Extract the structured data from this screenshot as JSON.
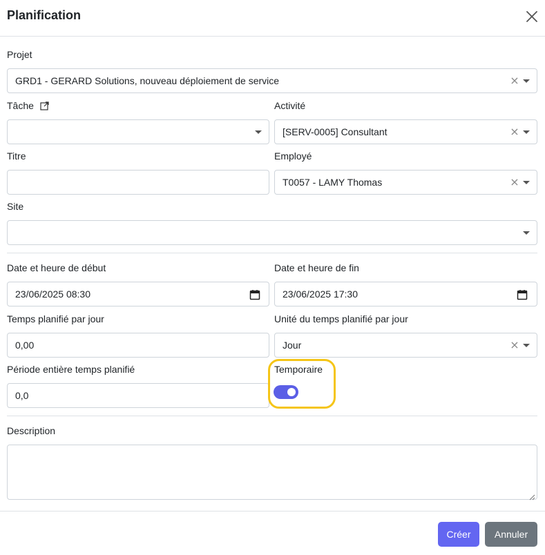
{
  "dialog": {
    "title": "Planification"
  },
  "form": {
    "projet": {
      "label": "Projet",
      "value": "GRD1 - GERARD Solutions, nouveau déploiement de service"
    },
    "tache": {
      "label": "Tâche",
      "value": ""
    },
    "activite": {
      "label": "Activité",
      "value": "[SERV-0005] Consultant"
    },
    "titre": {
      "label": "Titre",
      "value": ""
    },
    "employe": {
      "label": "Employé",
      "value": "T0057 - LAMY Thomas"
    },
    "site": {
      "label": "Site",
      "value": ""
    },
    "date_debut": {
      "label": "Date et heure de début",
      "value": "23/06/2025 08:30"
    },
    "date_fin": {
      "label": "Date et heure de fin",
      "value": "23/06/2025 17:30"
    },
    "temps_jour": {
      "label": "Temps planifié par jour",
      "value": "0,00"
    },
    "unite": {
      "label": "Unité du temps planifié par jour",
      "value": "Jour"
    },
    "periode": {
      "label": "Période entière temps planifié",
      "value": "0,0"
    },
    "temporaire": {
      "label": "Temporaire",
      "checked": true
    },
    "description": {
      "label": "Description",
      "value": ""
    }
  },
  "footer": {
    "create_label": "Créer",
    "cancel_label": "Annuler"
  },
  "colors": {
    "accent": "#6366f1",
    "toggle_on": "#5b5fe6",
    "highlight": "#f5c518",
    "secondary": "#6c757d"
  }
}
